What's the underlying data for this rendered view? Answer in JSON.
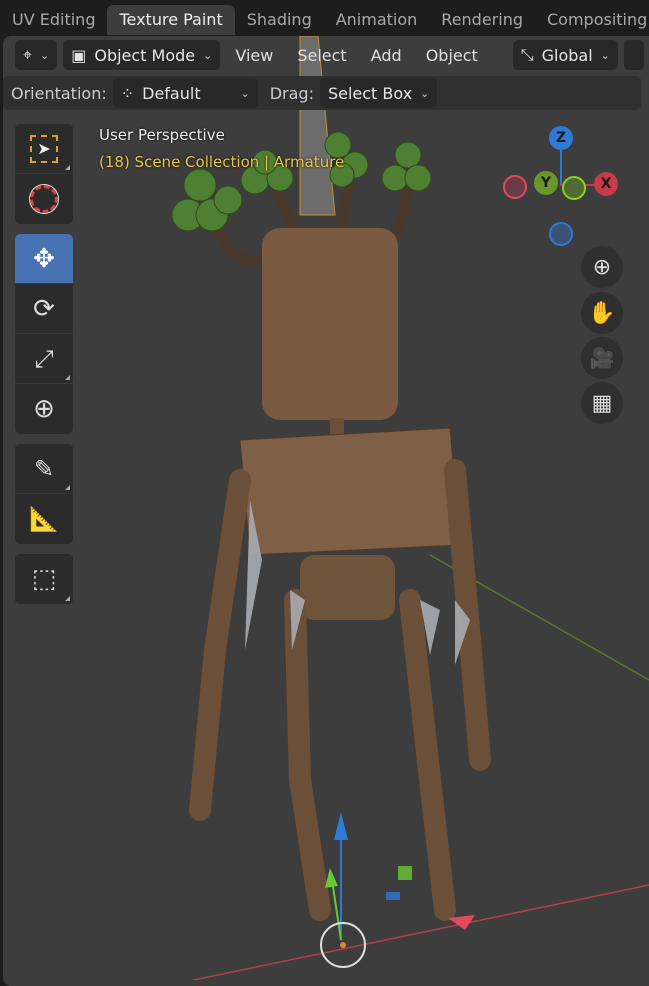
{
  "workspace_tabs": [
    {
      "label": "UV Editing",
      "active": false
    },
    {
      "label": "Texture Paint",
      "active": true
    },
    {
      "label": "Shading",
      "active": false
    },
    {
      "label": "Animation",
      "active": false
    },
    {
      "label": "Rendering",
      "active": false
    },
    {
      "label": "Compositing",
      "active": false
    }
  ],
  "header": {
    "editor_type_icon": "3d-viewport-icon",
    "mode": "Object Mode",
    "menus": [
      "View",
      "Select",
      "Add",
      "Object"
    ],
    "transform_orientation": "Global"
  },
  "tool_settings": {
    "orientation_label": "Orientation:",
    "orientation_value": "Default",
    "drag_label": "Drag:",
    "drag_value": "Select Box"
  },
  "viewport": {
    "view_name": "User Perspective",
    "collection_info": "(18) Scene Collection | Armature",
    "gizmo": {
      "z": "Z",
      "y": "Y",
      "x": "X",
      "x_color": "#c83a4a",
      "y_color": "#6a962a",
      "z_color": "#2e7bd6"
    },
    "nav_buttons": [
      "zoom-icon",
      "hand-pan-icon",
      "camera-icon",
      "grid-ortho-icon"
    ]
  },
  "toolbar": {
    "tools": [
      "select-box",
      "cursor",
      "move",
      "rotate",
      "scale",
      "transform",
      "annotate",
      "measure",
      "add-cube"
    ],
    "active": "move",
    "active_color": "#4772b3"
  }
}
